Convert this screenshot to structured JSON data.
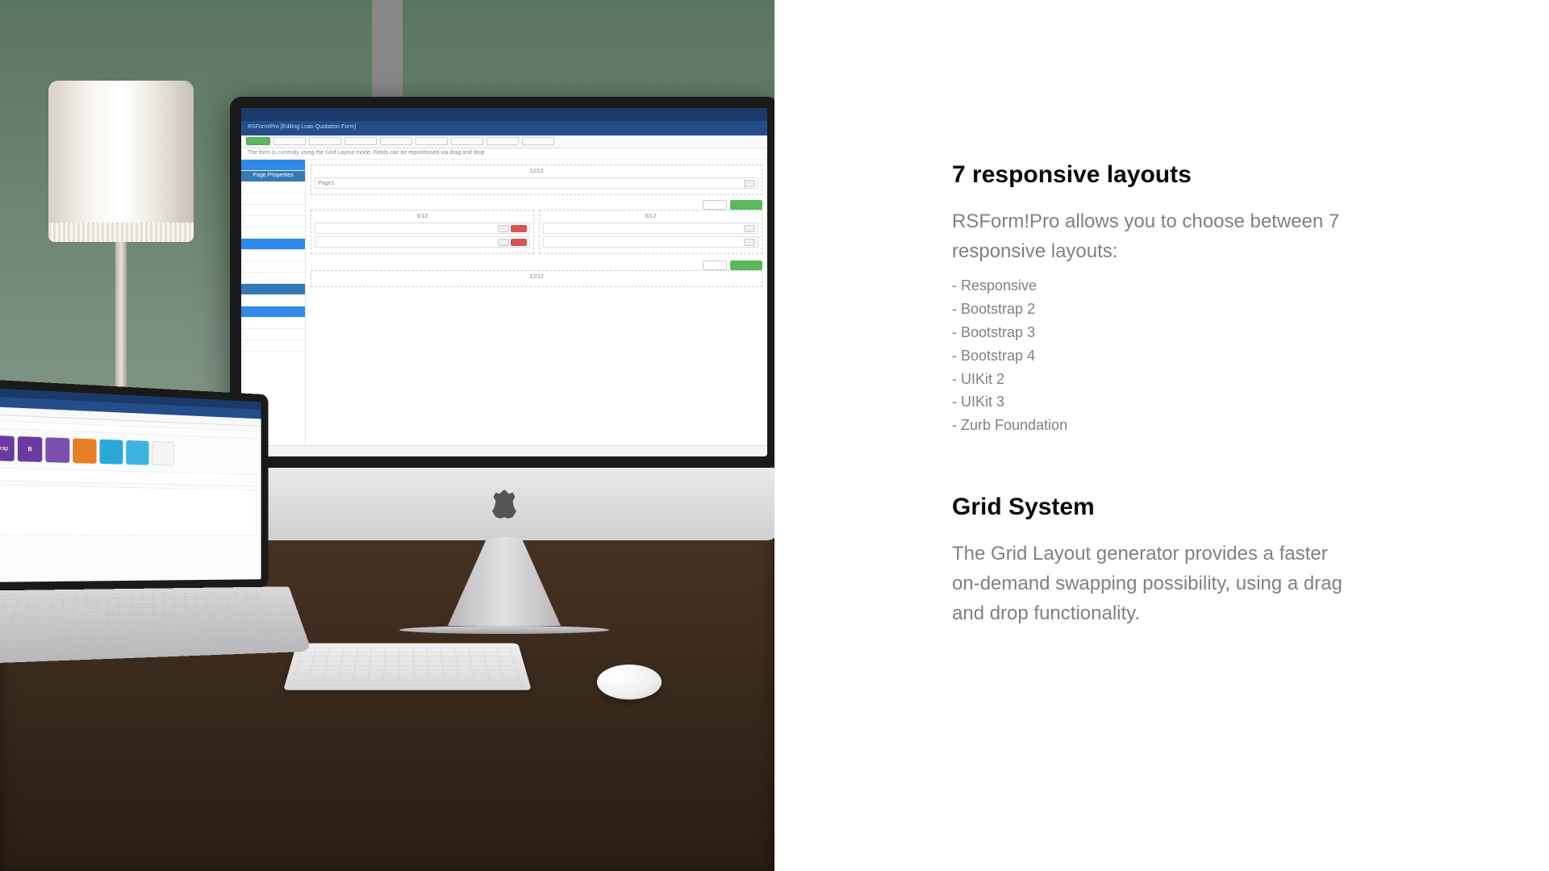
{
  "sections": {
    "layouts": {
      "heading": "7 responsive layouts",
      "lead": "RSForm!Pro allows you to choose between 7 responsive layouts:",
      "items": [
        "- Responsive",
        "- Bootstrap 2",
        "- Bootstrap 3",
        "- Bootstrap 4",
        "- UIKit 2",
        "- UIKit 3",
        "- Zurb Foundation"
      ]
    },
    "grid": {
      "heading": "Grid System",
      "lead": "The Grid Layout generator provides a faster on-demand swapping possibility, using a drag and drop functionality."
    }
  },
  "imac": {
    "title": "RSForm!Pro [Editing Loan Quotation Form]",
    "row_full": "12/12",
    "row_half": "6/12",
    "page_field": "Page1"
  },
  "laptop": {
    "boxes": [
      {
        "label": "strap",
        "color": "#6b3aa0"
      },
      {
        "label": "B",
        "color": "#6b3aa0"
      },
      {
        "label": "",
        "color": "#7a4fb0"
      },
      {
        "label": "",
        "color": "#e67e22"
      },
      {
        "label": "",
        "color": "#2aa8d8"
      },
      {
        "label": "",
        "color": "#3bb5e0"
      },
      {
        "label": "",
        "color": "#f5f5f5"
      }
    ]
  }
}
